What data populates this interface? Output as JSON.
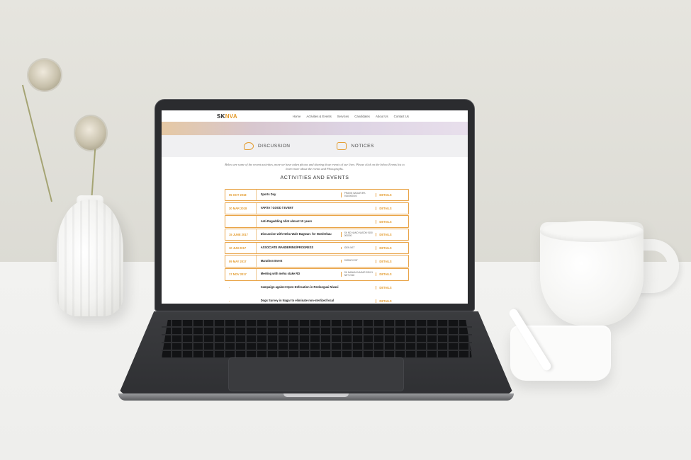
{
  "site": {
    "logo_main": "SK",
    "logo_accent": "NVA",
    "nav": [
      "Home",
      "Activities & Events",
      "Services",
      "Candidates",
      "About Us",
      "Contact Us"
    ]
  },
  "tabs": [
    {
      "label": "DISCUSSION",
      "icon": "speech-bubbles-icon"
    },
    {
      "label": "NOTICES",
      "icon": "notice-board-icon"
    }
  ],
  "intro_text": "Below are some of the recent activities, more we have taken photos and sharing those events of our lives. Please click on the below Events list to learn more about the events and Photographs.",
  "section_title": "ACTIVITIES AND EVENTS",
  "events": [
    {
      "date": "05 OCT 2018",
      "title": "Sports Day",
      "contact": "PRAVIN NAGAR 8PL 9150000000",
      "details": "DETAILS",
      "boxed": true
    },
    {
      "date": "30 MAR 2018",
      "title": "VARTA / GOOD / EVENT",
      "contact": "",
      "details": "DETAILS",
      "boxed": true
    },
    {
      "date": "",
      "title": "Anti-Ragadding Allot almost 10 years",
      "contact": "",
      "details": "DETAILS",
      "boxed": true
    },
    {
      "date": "15 JUNE 2017",
      "title": "Discussion with Nebu Wale Bagwan: for Nowlerbau",
      "contact": "SK ND NANO NASON 9150 000000",
      "details": "DETAILS",
      "boxed": true
    },
    {
      "date": "10 JUN 2017",
      "title": "ASSOCIATE WANDERING/PROGRESS",
      "contact": "IDEN NET",
      "details": "DETAILS",
      "boxed": true
    },
    {
      "date": "09 MAY 2017",
      "title": "Marathon Event",
      "contact": "SKRARI ENT",
      "details": "DETAILS",
      "boxed": true
    },
    {
      "date": "17 NOV 2017",
      "title": "Meeting with mehu stake RD",
      "contact": "SK NAWANI NAGAR 9SK01 NET 2018",
      "details": "DETAILS",
      "boxed": true
    },
    {
      "date": "-",
      "title": "Campaign against Open Defecation in Reelanguai Nivasi",
      "contact": "",
      "details": "DETAILS",
      "boxed": false
    },
    {
      "date": "-",
      "title": "Dogs Survey in Nagar to eliminate non-sterlized local",
      "contact": "",
      "details": "DETAILS",
      "boxed": false
    }
  ]
}
